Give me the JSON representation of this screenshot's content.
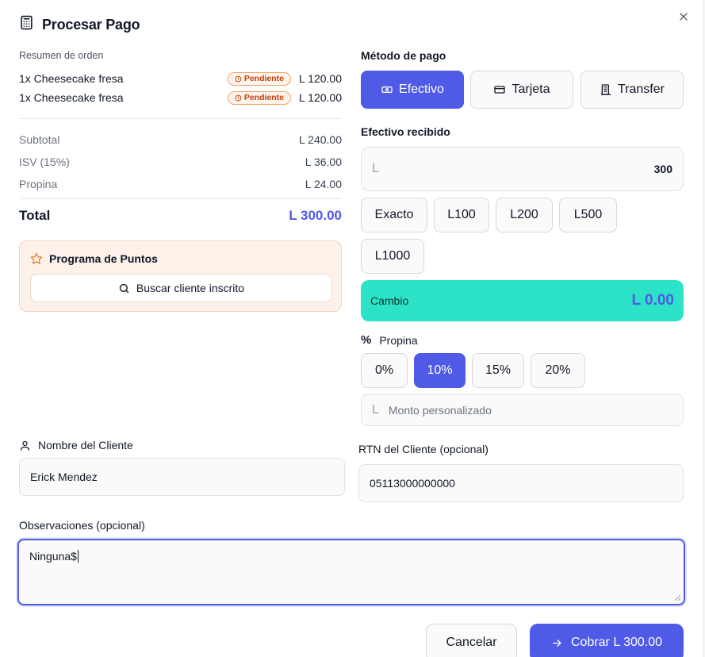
{
  "dialog": {
    "title": "Procesar Pago",
    "close_icon": "close-icon"
  },
  "order": {
    "summary_label": "Resumen de orden",
    "items": [
      {
        "name": "1x Cheesecake fresa",
        "status": "Pendiente",
        "price": "L 120.00"
      },
      {
        "name": "1x Cheesecake fresa",
        "status": "Pendiente",
        "price": "L 120.00"
      }
    ],
    "subtotal_label": "Subtotal",
    "subtotal": "L 240.00",
    "isv_label": "ISV (15%)",
    "isv": "L 36.00",
    "tip_label": "Propina",
    "tip": "L 24.00",
    "total_label": "Total",
    "total": "L 300.00"
  },
  "points": {
    "title": "Programa de Puntos",
    "search_label": "Buscar cliente inscrito"
  },
  "payment": {
    "method_label": "Método de pago",
    "methods": [
      {
        "label": "Efectivo",
        "icon": "banknote-icon",
        "active": true
      },
      {
        "label": "Tarjeta",
        "icon": "credit-card-icon",
        "active": false
      },
      {
        "label": "Transfer",
        "icon": "bank-icon",
        "active": false
      }
    ],
    "cash_label": "Efectivo recibido",
    "currency_prefix": "L",
    "cash_value": "300",
    "quick_amounts": [
      "Exacto",
      "L100",
      "L200",
      "L500",
      "L1000"
    ],
    "change_label": "Cambio",
    "change_value": "L 0.00"
  },
  "tip": {
    "label": "Propina",
    "options": [
      "0%",
      "10%",
      "15%",
      "20%"
    ],
    "selected": "10%",
    "custom_prefix": "L",
    "custom_placeholder": "Monto personalizado"
  },
  "customer": {
    "name_label": "Nombre del Cliente",
    "name_value": "Erick Mendez",
    "rtn_label": "RTN del Cliente (opcional)",
    "rtn_value": "05113000000000"
  },
  "notes": {
    "label": "Observaciones (opcional)",
    "value": "Ninguna$"
  },
  "footer": {
    "cancel_label": "Cancelar",
    "charge_label": "Cobrar L 300.00"
  },
  "colors": {
    "accent": "#4f5ae6",
    "change_bg": "#2ce3c8",
    "pending_badge": "#c2410c"
  }
}
